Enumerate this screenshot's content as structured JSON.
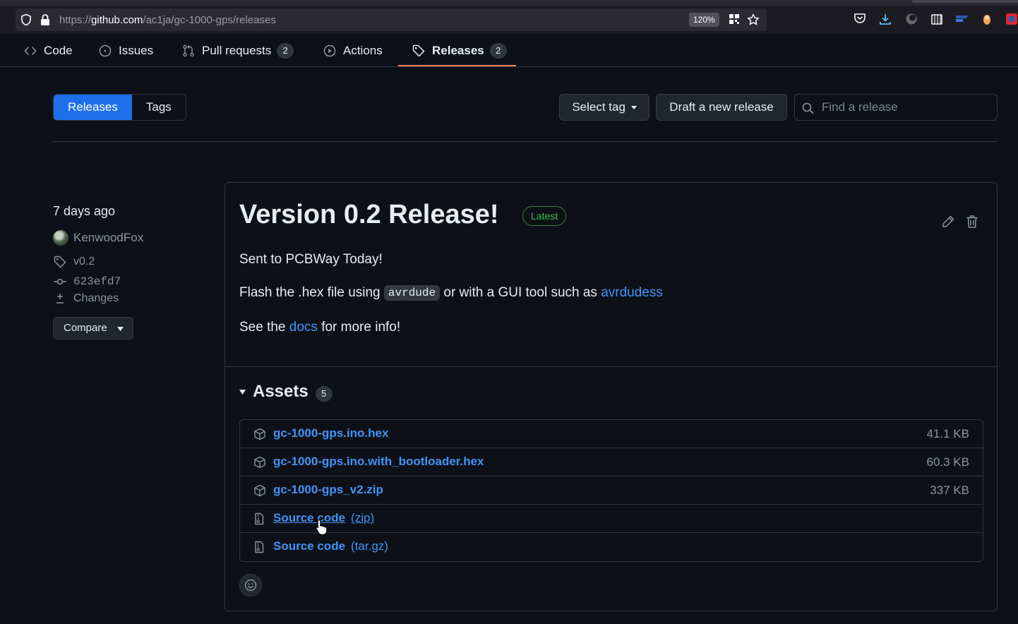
{
  "browser": {
    "url_prefix": "https://",
    "url_host": "github.com",
    "url_path": "/ac1ja/gc-1000-gps/releases",
    "zoom": "120%"
  },
  "repo_nav": {
    "tabs": [
      {
        "label": "Code",
        "icon": "code-icon"
      },
      {
        "label": "Issues",
        "icon": "issue-icon"
      },
      {
        "label": "Pull requests",
        "icon": "pull-request-icon",
        "count": "2"
      },
      {
        "label": "Actions",
        "icon": "play-icon"
      },
      {
        "label": "Releases",
        "icon": "tag-icon",
        "count": "2",
        "active": true
      }
    ]
  },
  "subnav": {
    "segments": [
      "Releases",
      "Tags"
    ],
    "select_tag": "Select tag",
    "draft_release": "Draft a new release",
    "search_placeholder": "Find a release"
  },
  "sidebar": {
    "time": "7 days ago",
    "author": "KenwoodFox",
    "tag": "v0.2",
    "commit": "623efd7",
    "changes": "Changes",
    "compare": "Compare"
  },
  "release": {
    "title": "Version 0.2 Release!",
    "badge": "Latest",
    "line1": "Sent to PCBWay Today!",
    "line2_a": "Flash the .hex file using ",
    "line2_code": "avrdude",
    "line2_b": " or with a GUI tool such as ",
    "line2_link": "avrdudess",
    "line3_a": "See the ",
    "line3_link": "docs",
    "line3_b": " for more info!"
  },
  "assets": {
    "title": "Assets",
    "count": "5",
    "items": [
      {
        "name": "gc-1000-gps.ino.hex",
        "size": "41.1 KB",
        "icon": "package-icon"
      },
      {
        "name": "gc-1000-gps.ino.with_bootloader.hex",
        "size": "60.3 KB",
        "icon": "package-icon"
      },
      {
        "name": "gc-1000-gps_v2.zip",
        "size": "337 KB",
        "icon": "package-icon"
      },
      {
        "name": "Source code",
        "sub": "(zip)",
        "icon": "file-zip-icon"
      },
      {
        "name": "Source code",
        "sub": "(tar.gz)",
        "icon": "file-zip-icon"
      }
    ]
  },
  "colors": {
    "accent": "#1f6feb",
    "link": "#4493f8",
    "tab_underline": "#f78166",
    "latest": "#3fb950"
  }
}
